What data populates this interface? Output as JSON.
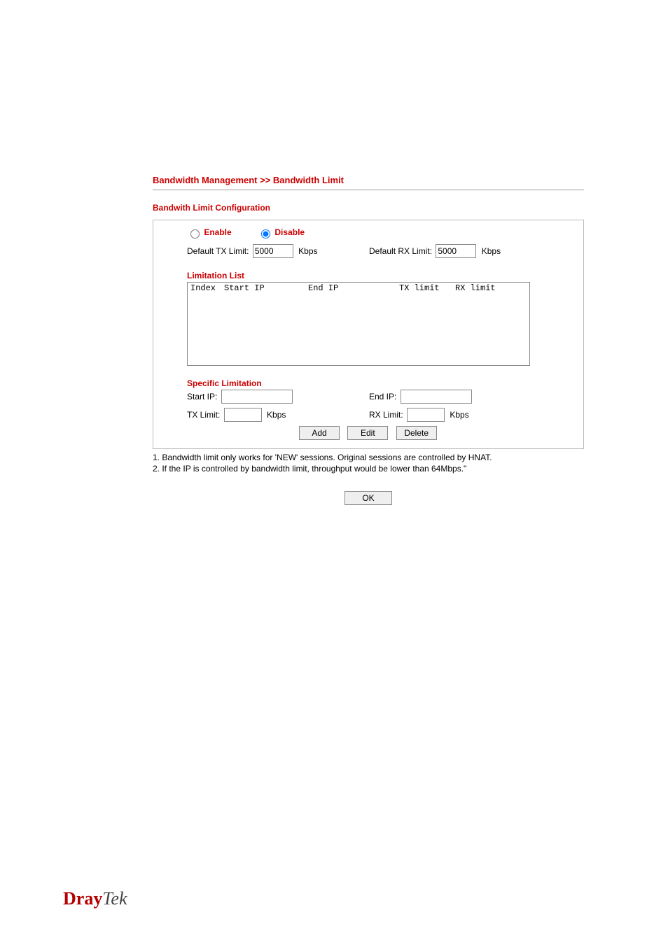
{
  "breadcrumb": "Bandwidth Management >> Bandwidth Limit",
  "section_title": "Bandwith Limit Configuration",
  "radios": {
    "enable_label": "Enable",
    "disable_label": "Disable",
    "selected": "disable"
  },
  "defaults": {
    "tx_label": "Default TX Limit:",
    "tx_value": "5000",
    "tx_unit": "Kbps",
    "rx_label": "Default RX Limit:",
    "rx_value": "5000",
    "rx_unit": "Kbps"
  },
  "limitation_list": {
    "heading": "Limitation List",
    "col_index": "Index",
    "col_start": "Start IP",
    "col_end": "End IP",
    "col_tx": "TX limit",
    "col_rx": "RX limit",
    "rows": []
  },
  "specific": {
    "heading": "Specific Limitation",
    "start_ip_label": "Start IP:",
    "start_ip_value": "",
    "end_ip_label": "End IP:",
    "end_ip_value": "",
    "tx_limit_label": "TX Limit:",
    "tx_limit_value": "",
    "tx_unit": "Kbps",
    "rx_limit_label": "RX Limit:",
    "rx_limit_value": "",
    "rx_unit": "Kbps"
  },
  "buttons": {
    "add": "Add",
    "edit": "Edit",
    "delete": "Delete",
    "ok": "OK"
  },
  "notes": {
    "n1": "1. Bandwidth limit only works for 'NEW' sessions. Original sessions are controlled by HNAT.",
    "n2": "2. If the IP is controlled by bandwidth limit, throughput would be lower than 64Mbps.\""
  },
  "logo": {
    "part1": "Dray",
    "part2": "Tek"
  }
}
